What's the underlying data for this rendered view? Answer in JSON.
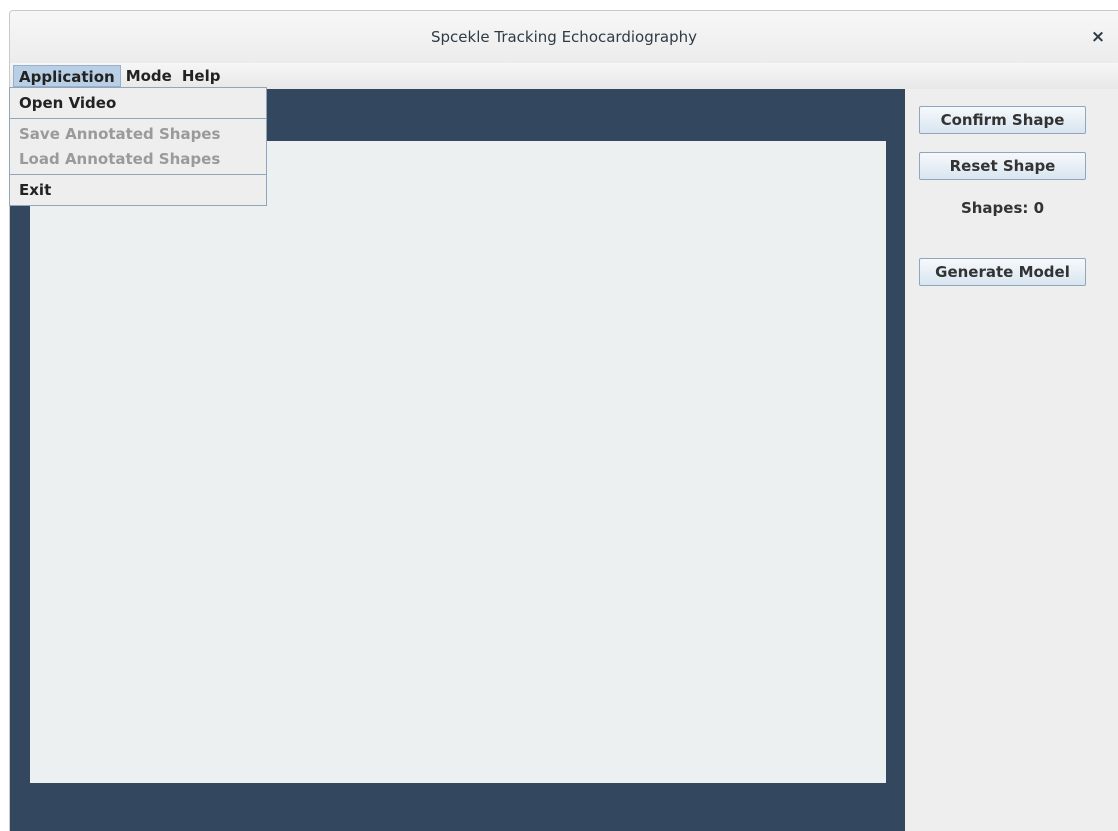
{
  "window": {
    "title": "Spcekle Tracking Echocardiography",
    "close_glyph": "×"
  },
  "menubar": {
    "items": [
      {
        "label": "Application",
        "active": true
      },
      {
        "label": "Mode",
        "active": false
      },
      {
        "label": "Help",
        "active": false
      }
    ]
  },
  "application_menu": {
    "open_video": "Open Video",
    "save_annotated": "Save Annotated Shapes",
    "load_annotated": "Load Annotated Shapes",
    "exit": "Exit"
  },
  "side_panel": {
    "confirm_shape": "Confirm Shape",
    "reset_shape": "Reset Shape",
    "shapes_count": "Shapes: 0",
    "generate_model": "Generate Model"
  },
  "colors": {
    "canvas_bg": "#33485f",
    "video_panel_bg": "#ecf0f1",
    "menu_highlight": "#b8cfe5"
  },
  "icons": {
    "close": "close-icon"
  }
}
